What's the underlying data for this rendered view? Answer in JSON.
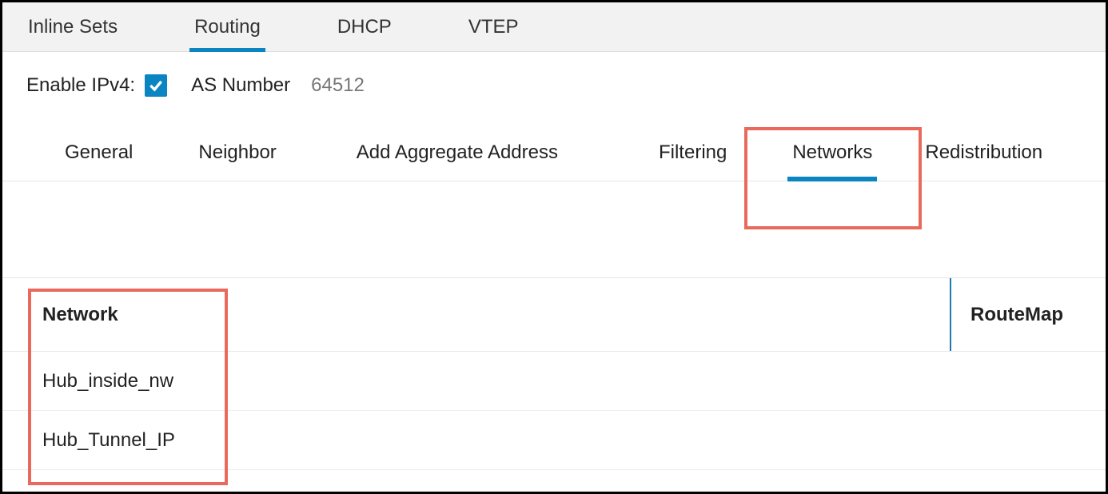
{
  "top_tabs": {
    "items": [
      {
        "label": "Inline Sets",
        "active": false
      },
      {
        "label": "Routing",
        "active": true
      },
      {
        "label": "DHCP",
        "active": false
      },
      {
        "label": "VTEP",
        "active": false
      }
    ]
  },
  "enable_row": {
    "label": "Enable IPv4:",
    "checked": true,
    "as_label": "AS Number",
    "as_value": "64512"
  },
  "sub_tabs": {
    "items": [
      {
        "label": "General",
        "active": false
      },
      {
        "label": "Neighbor",
        "active": false
      },
      {
        "label": "Add Aggregate Address",
        "active": false
      },
      {
        "label": "Filtering",
        "active": false
      },
      {
        "label": "Networks",
        "active": true
      },
      {
        "label": "Redistribution",
        "active": false
      }
    ]
  },
  "table": {
    "headers": {
      "network": "Network",
      "routemap": "RouteMap"
    },
    "rows": [
      {
        "network": "Hub_inside_nw",
        "routemap": ""
      },
      {
        "network": "Hub_Tunnel_IP",
        "routemap": ""
      }
    ]
  },
  "colors": {
    "accent": "#0a85c2",
    "highlight": "#e96a5c"
  }
}
